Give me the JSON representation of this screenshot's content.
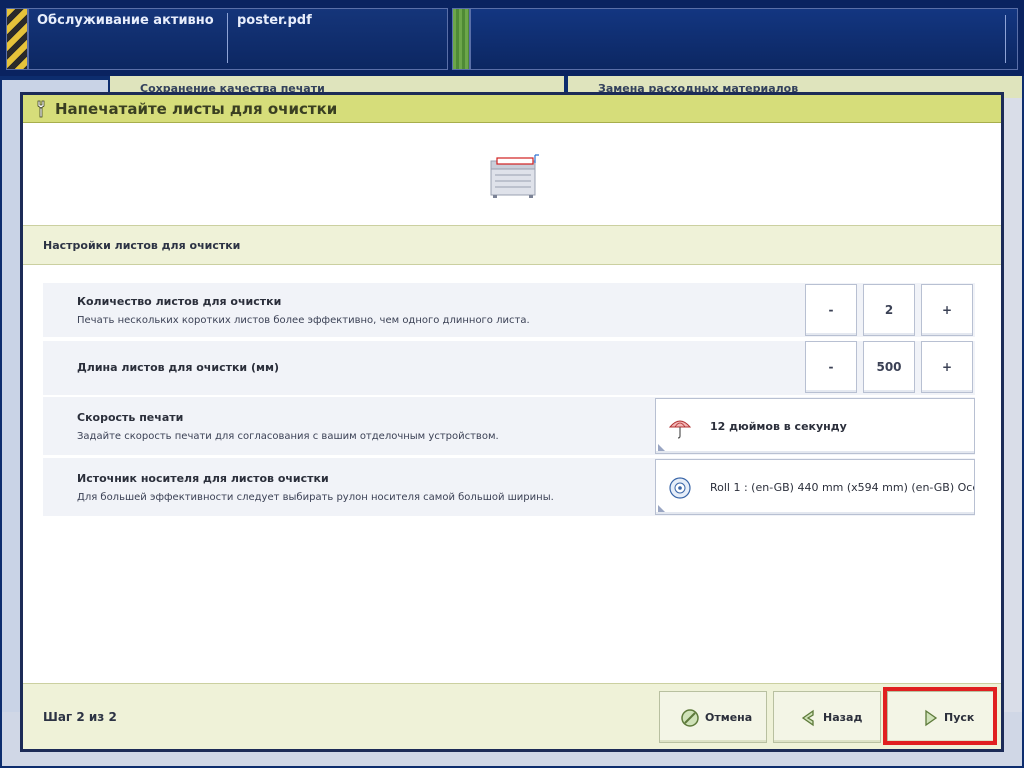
{
  "topbar": {
    "status": "Обслуживание активно",
    "file": "poster.pdf"
  },
  "background": {
    "tab_left": "Сохранение качества печати",
    "tab_right": "Замена расходных материалов"
  },
  "dialog": {
    "title": "Напечатайте листы для очистки",
    "section_title": "Настройки листов для очистки",
    "rows": [
      {
        "title": "Количество листов для очистки",
        "description": "Печать нескольких коротких листов более эффективно, чем одного длинного листа.",
        "decrement": "-",
        "value": "2",
        "increment": "+"
      },
      {
        "title": "Длина листов для очистки (мм)",
        "decrement": "-",
        "value": "500",
        "increment": "+"
      },
      {
        "title": "Скорость печати",
        "description": "Задайте скорость печати для согласования с вашим отделочным устройством.",
        "value": "12 дюймов в секунду",
        "icon": "umbrella-speed-icon"
      },
      {
        "title": "Источник носителя для листов очистки",
        "description": "Для большей эффективности следует выбирать рулон носителя самой большой ширины.",
        "value": "Roll 1 : (en-GB) 440 mm (x594 mm) (en-GB) Océ ...",
        "icon": "media-roll-icon"
      }
    ],
    "footer": {
      "step": "Шаг 2 из 2",
      "cancel": "Отмена",
      "back": "Назад",
      "start": "Пуск"
    }
  },
  "colors": {
    "header_bg": "#d6dd7a",
    "band_bg": "#eff2d8",
    "highlight": "#e02020",
    "topbar_bg": "#0a2360"
  }
}
